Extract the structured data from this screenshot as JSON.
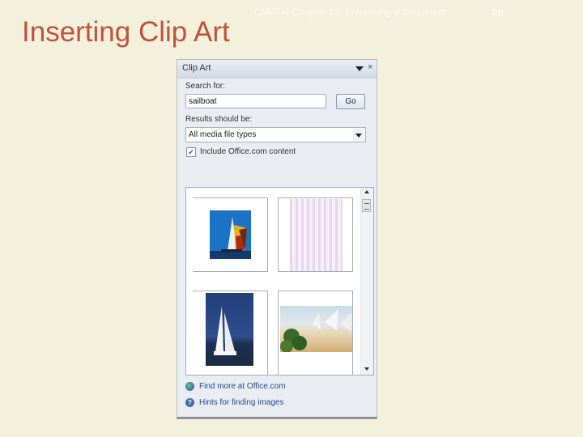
{
  "slide": {
    "title": "Inserting Clip Art",
    "footer": "CMPTR Chapter 12: Enhancing a Document",
    "page_number": "26"
  },
  "pane": {
    "title": "Clip Art",
    "close_glyph": "×",
    "search_label": "Search for:",
    "search_value": "sailboat",
    "go_label": "Go",
    "results_label": "Results should be:",
    "results_selected": "All media file types",
    "include_label": "Include Office.com content",
    "include_checked": true,
    "check_glyph": "✔",
    "results": [
      {
        "name": "sailboat-clipart-colorful-sail"
      },
      {
        "name": "text-document-preview"
      },
      {
        "name": "white-sailboat-photo"
      },
      {
        "name": "beach-sailboats-photo"
      }
    ],
    "links": [
      {
        "label": "Find more at Office.com",
        "icon": "office-globe-icon"
      },
      {
        "label": "Hints for finding images",
        "icon": "help-icon",
        "glyph": "?"
      }
    ]
  },
  "colors": {
    "title": "#c0533d",
    "background": "#f3f0dc",
    "link": "#1f4e93"
  }
}
